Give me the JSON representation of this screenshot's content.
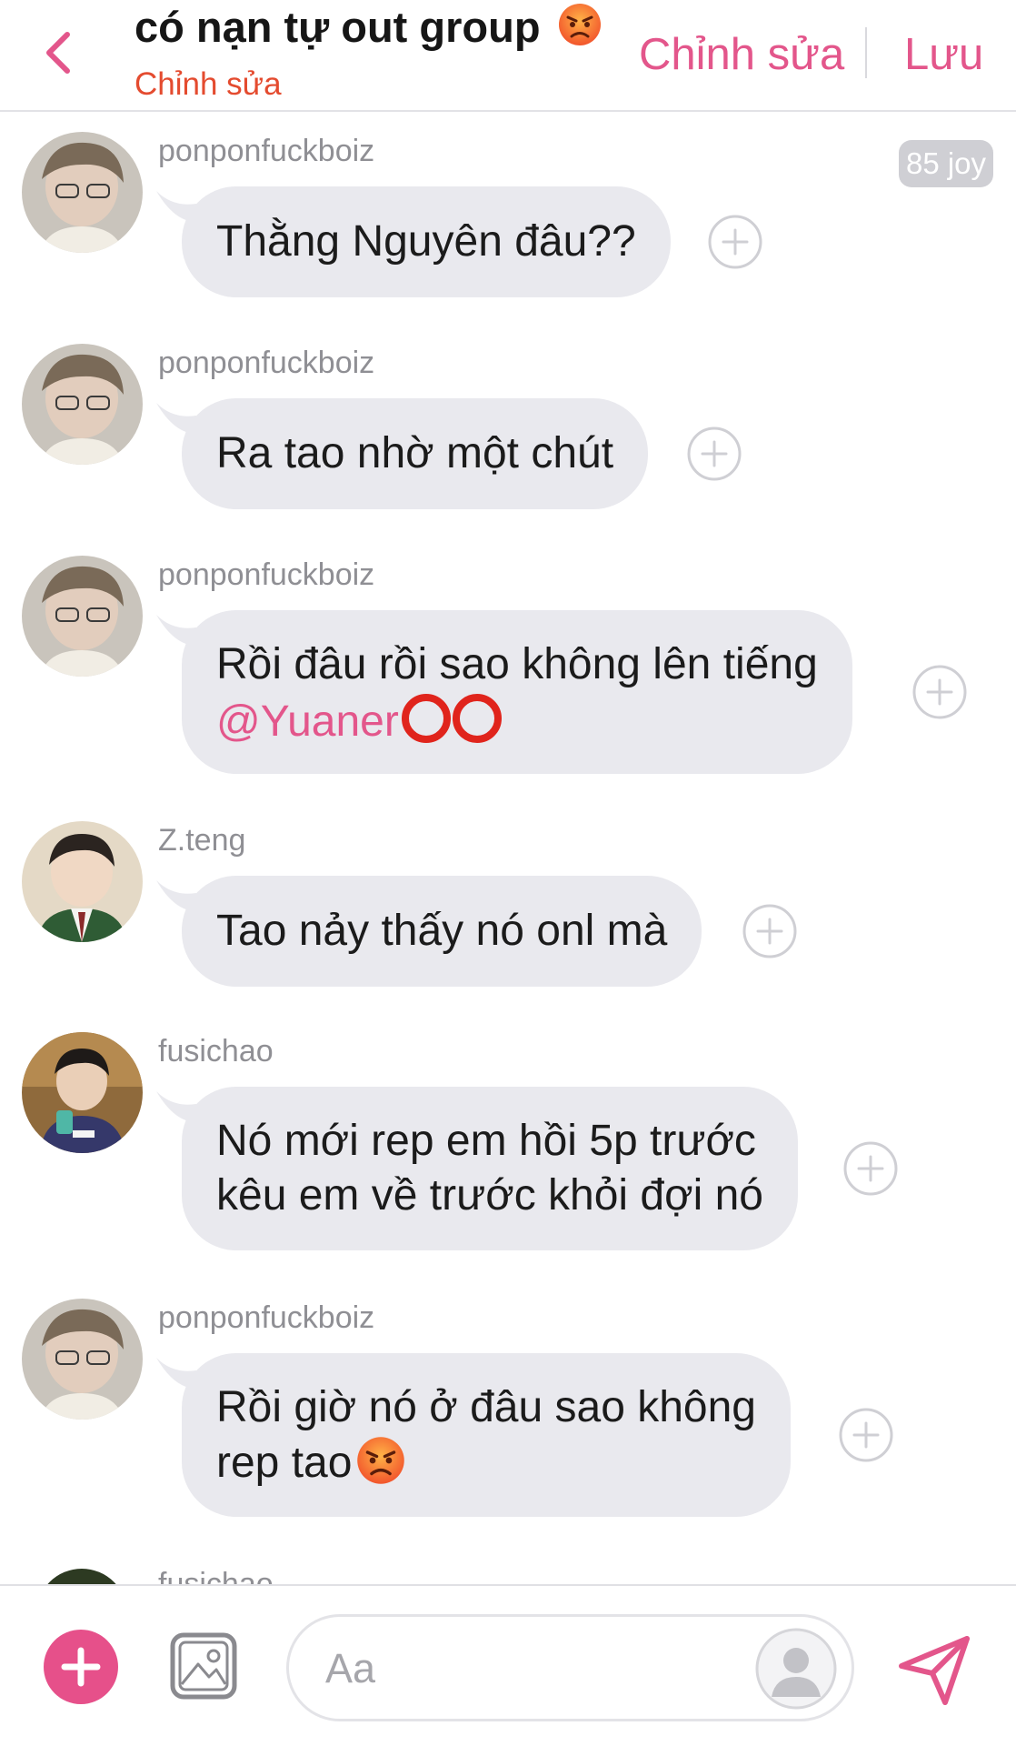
{
  "header": {
    "title": "có nạn tự out group",
    "title_emoji": "angry-face",
    "subtitle": "Chỉnh sửa",
    "edit_label": "Chỉnh sửa",
    "save_label": "Lưu"
  },
  "badge": {
    "label": "85 joy"
  },
  "messages": [
    {
      "user": "ponponfuckboiz",
      "text": "Thằng Nguyên đâu??"
    },
    {
      "user": "ponponfuckboiz",
      "text": "Ra tao nhờ một chút"
    },
    {
      "user": "ponponfuckboiz",
      "line1": "Rồi đâu rồi sao không lên tiếng",
      "mention": "@Yuaner",
      "trailing_icons": "two-red-rings"
    },
    {
      "user": "Z.teng",
      "text": "Tao nảy thấy nó onl mà"
    },
    {
      "user": "fusichao",
      "line1": "Nó mới rep em hồi 5p trước",
      "line2": "kêu em về trước khỏi đợi nó"
    },
    {
      "user": "ponponfuckboiz",
      "line1": "Rồi giờ nó ở đâu sao không",
      "line2": "rep tao",
      "trailing_icons": "angry-face"
    }
  ],
  "partial_message": {
    "user": "fusichao"
  },
  "composer": {
    "placeholder": "Aa"
  },
  "colors": {
    "accent": "#e3568b",
    "subtitle": "#e44b2f",
    "bubble": "#e9e9ee",
    "username": "#8f8f94"
  }
}
